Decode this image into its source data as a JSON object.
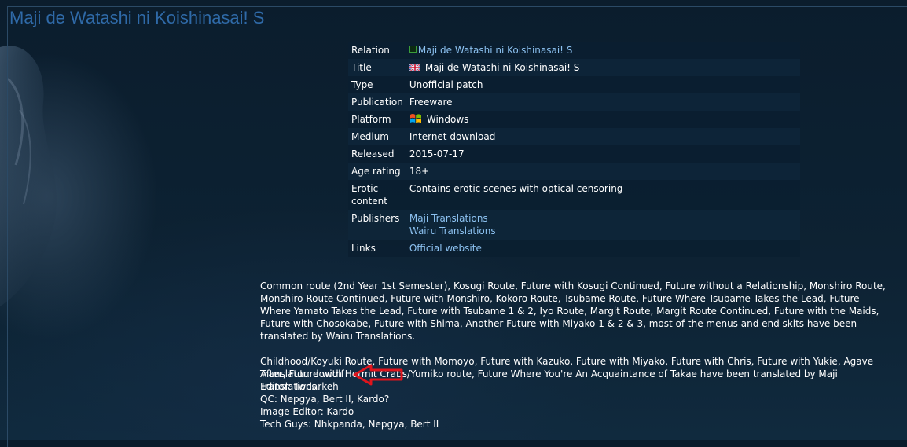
{
  "page_title": "Maji de Watashi ni Koishinasai! S",
  "details": {
    "relation": {
      "label": "Relation",
      "value": "Maji de Watashi ni Koishinasai! S"
    },
    "title": {
      "label": "Title",
      "value": "Maji de Watashi ni Koishinasai! S"
    },
    "type": {
      "label": "Type",
      "value": "Unofficial patch"
    },
    "publication": {
      "label": "Publication",
      "value": "Freeware"
    },
    "platform": {
      "label": "Platform",
      "value": "Windows"
    },
    "medium": {
      "label": "Medium",
      "value": "Internet download"
    },
    "released": {
      "label": "Released",
      "value": "2015-07-17"
    },
    "age_rating": {
      "label": "Age rating",
      "value": "18+"
    },
    "erotic": {
      "label": "Erotic content",
      "value": "Contains erotic scenes with optical censoring"
    },
    "publishers": {
      "label": "Publishers",
      "values": [
        "Maji Translations",
        "Wairu Translations"
      ]
    },
    "links": {
      "label": "Links",
      "value": "Official website"
    }
  },
  "description": {
    "paragraph1": "Common route (2nd Year 1st Semester), Kosugi Route, Future with Kosugi Continued, Future without a Relationship, Monshiro Route, Monshiro Route Continued, Future with Monshiro, Kokoro Route, Tsubame Route, Future Where Tsubame Takes the Lead, Future Where Yamato Takes the Lead, Future with Tsubame 1 & 2, Iyo Route, Margit Route, Margit Route Continued, Future with the Maids, Future with Chosokabe, Future with Shima, Another Future with Miyako 1 & 2 & 3, most of the menus and end skits have been translated by Wairu Translations.",
    "paragraph2": "Childhood/Koyuki Route, Future with Momoyo, Future with Kazuko, Future with Miyako, Future with Chris, Future with Yukie, Agave After, Future with Hermit Crabs/Yumiko route, Future Where You're An Acquaintance of Takae have been translated by Maji Translations."
  },
  "credits": {
    "translator": "Translator: dowolf",
    "editor": "Editor: Twdarkeh",
    "qc": "QC: Nepgya, Bert II, Kardo?",
    "image_editor": "Image Editor: Kardo",
    "tech": "Tech Guys: Nhkpanda, Nepgya, Bert II"
  },
  "colors": {
    "background": "#0a1c2c",
    "title": "#2f6aa8",
    "link": "#8cc1f0",
    "arrow": "#e0141c"
  },
  "icons": [
    "plus-icon",
    "uk-flag-icon",
    "windows-icon",
    "red-arrow-icon"
  ]
}
